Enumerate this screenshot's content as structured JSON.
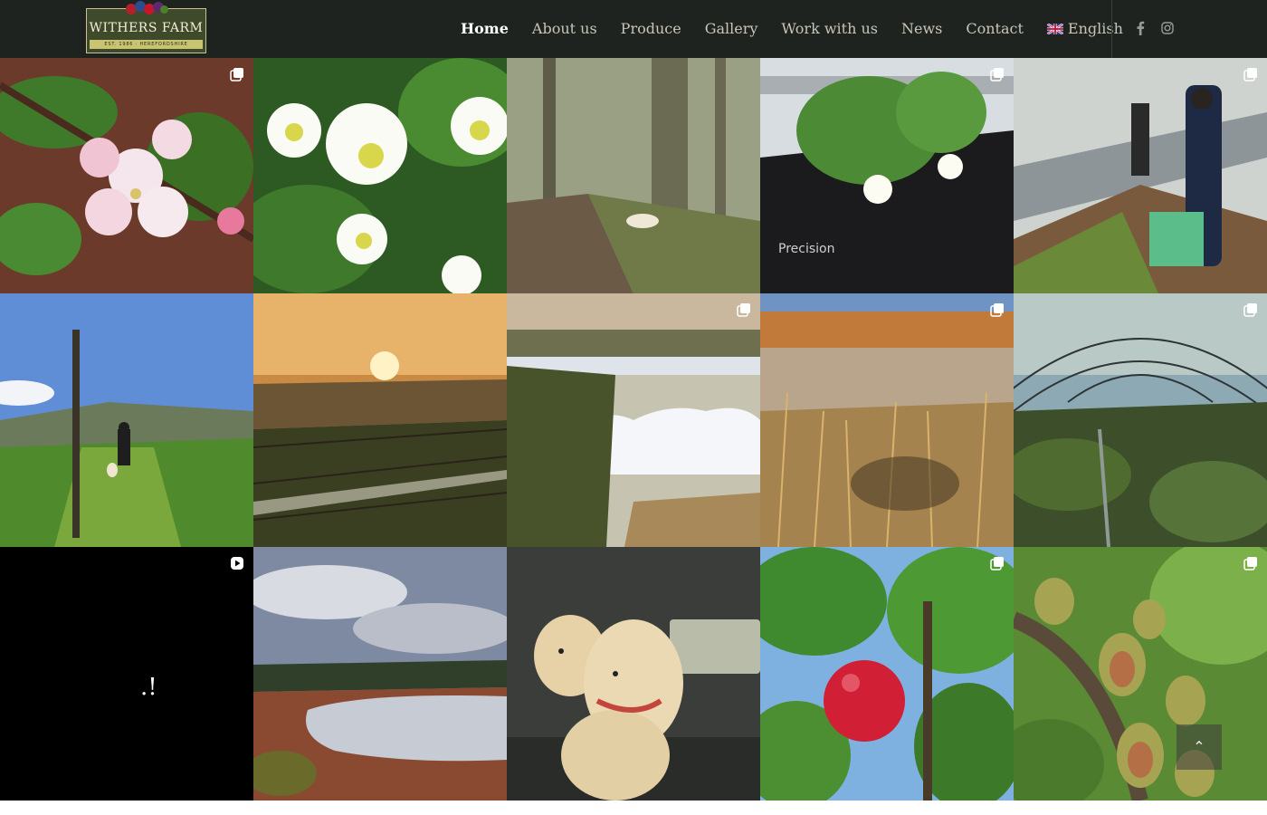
{
  "brand": {
    "name": "WITHERS FARM",
    "tagline": "EST. 1986 · HEREFORDSHIRE"
  },
  "nav": {
    "items": [
      {
        "label": "Home",
        "active": true
      },
      {
        "label": "About us"
      },
      {
        "label": "Produce"
      },
      {
        "label": "Gallery"
      },
      {
        "label": "Work with us"
      },
      {
        "label": "News"
      },
      {
        "label": "Contact"
      }
    ],
    "language": "English"
  },
  "social": {
    "facebook_icon": "facebook-icon",
    "instagram_icon": "instagram-icon"
  },
  "gallery": {
    "tiles": [
      {
        "subject": "apple-blossom",
        "badge": "multi-image"
      },
      {
        "subject": "strawberry-flowers",
        "badge": "none"
      },
      {
        "subject": "dog-on-woodland-path",
        "badge": "none"
      },
      {
        "subject": "strawberry-plant-in-grow-bag",
        "badge": "multi-image"
      },
      {
        "subject": "workers-in-polytunnel",
        "badge": "multi-image"
      },
      {
        "subject": "man-and-dog-in-orchard",
        "badge": "none"
      },
      {
        "subject": "sunset-over-vines",
        "badge": "none"
      },
      {
        "subject": "snow-covered-polytunnels",
        "badge": "multi-image"
      },
      {
        "subject": "reeds-by-reservoir",
        "badge": "multi-image"
      },
      {
        "subject": "polytunnel-frames",
        "badge": "multi-image"
      },
      {
        "subject": "dark-video",
        "badge": "video",
        "overlay_text": ".!"
      },
      {
        "subject": "reservoir-under-cloudy-sky",
        "badge": "none"
      },
      {
        "subject": "two-labradors-in-vehicle",
        "badge": "none"
      },
      {
        "subject": "red-apple-on-branch",
        "badge": "multi-image"
      },
      {
        "subject": "kiwi-berries",
        "badge": "multi-image"
      }
    ]
  },
  "scroll_top": "⌃",
  "colors": {
    "header_bg": "#1f2320",
    "nav_text": "#c9c5b8",
    "nav_active": "#ffffff",
    "logo_bg": "#3f4a2b",
    "logo_strip": "#c9c472"
  }
}
